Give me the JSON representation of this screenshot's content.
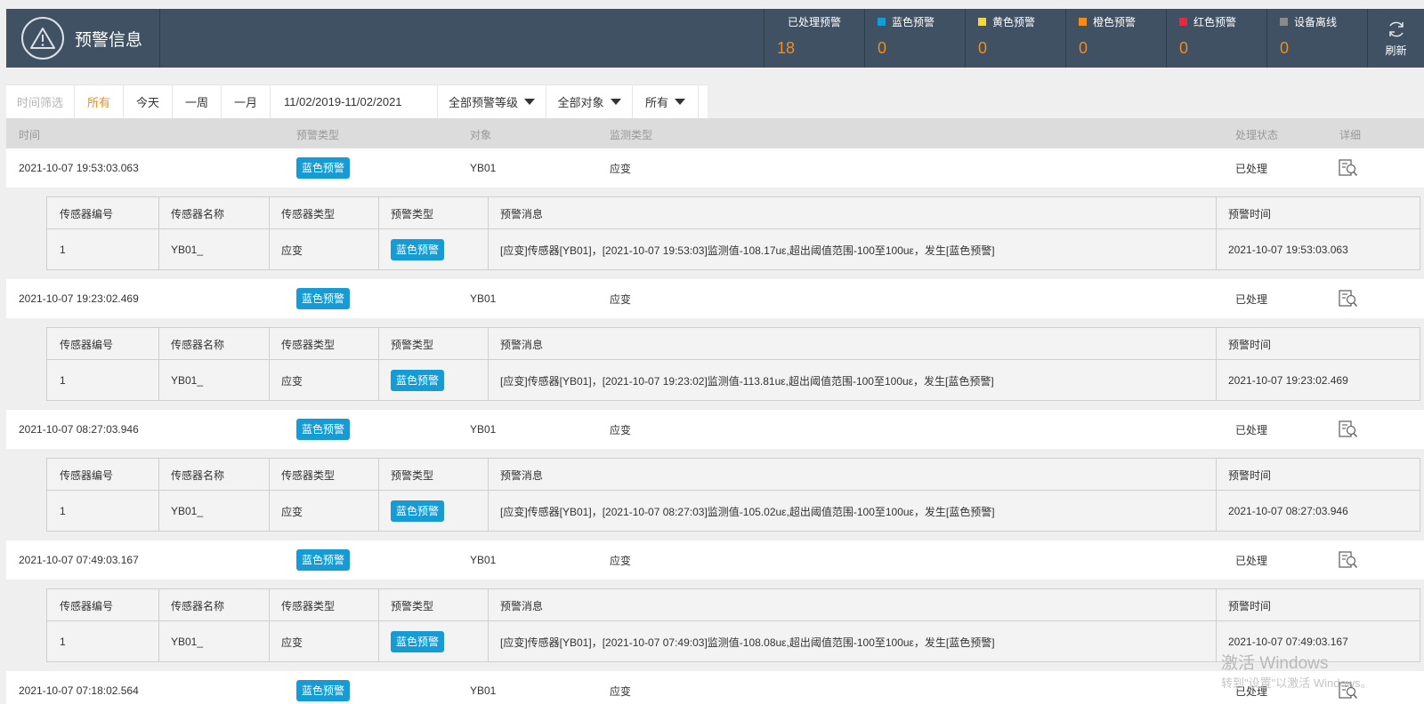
{
  "header": {
    "title": "预警信息",
    "stats": [
      {
        "label": "已处理预警",
        "value": "18",
        "swatch": ""
      },
      {
        "label": "蓝色预警",
        "value": "0",
        "swatch": "#169bd5"
      },
      {
        "label": "黄色预警",
        "value": "0",
        "swatch": "#f5d63d"
      },
      {
        "label": "橙色预警",
        "value": "0",
        "swatch": "#f28c1b"
      },
      {
        "label": "红色预警",
        "value": "0",
        "swatch": "#e8283c"
      },
      {
        "label": "设备离线",
        "value": "0",
        "swatch": "#8a8a8a"
      }
    ],
    "refresh_label": "刷新"
  },
  "filters": {
    "label": "时间筛选",
    "options": [
      "所有",
      "今天",
      "一周",
      "一月"
    ],
    "active": "所有",
    "date_range": "11/02/2019-11/02/2021",
    "level_dropdown": "全部预警等级",
    "object_dropdown": "全部对象",
    "status_dropdown": "所有"
  },
  "columns": {
    "time": "时间",
    "alert_type": "预警类型",
    "object": "对象",
    "monitor_type": "监测类型",
    "status": "处理状态",
    "detail": "详细"
  },
  "sub_columns": {
    "sensor_id": "传感器编号",
    "sensor_name": "传感器名称",
    "sensor_type": "传感器类型",
    "alert_type": "预警类型",
    "message": "预警消息",
    "alert_time": "预警时间"
  },
  "alerts": [
    {
      "time": "2021-10-07 19:53:03.063",
      "alert_type": "蓝色预警",
      "object": "YB01",
      "monitor_type": "应变",
      "status": "已处理",
      "detail": {
        "sensor_id": "1",
        "sensor_name": "YB01_",
        "sensor_type": "应变",
        "alert_type": "蓝色预警",
        "message": "[应变]传感器[YB01]，[2021-10-07 19:53:03]监测值-108.17uε,超出阈值范围-100至100uε，发生[蓝色预警]",
        "alert_time": "2021-10-07 19:53:03.063"
      }
    },
    {
      "time": "2021-10-07 19:23:02.469",
      "alert_type": "蓝色预警",
      "object": "YB01",
      "monitor_type": "应变",
      "status": "已处理",
      "detail": {
        "sensor_id": "1",
        "sensor_name": "YB01_",
        "sensor_type": "应变",
        "alert_type": "蓝色预警",
        "message": "[应变]传感器[YB01]，[2021-10-07 19:23:02]监测值-113.81uε,超出阈值范围-100至100uε，发生[蓝色预警]",
        "alert_time": "2021-10-07 19:23:02.469"
      }
    },
    {
      "time": "2021-10-07 08:27:03.946",
      "alert_type": "蓝色预警",
      "object": "YB01",
      "monitor_type": "应变",
      "status": "已处理",
      "detail": {
        "sensor_id": "1",
        "sensor_name": "YB01_",
        "sensor_type": "应变",
        "alert_type": "蓝色预警",
        "message": "[应变]传感器[YB01]，[2021-10-07 08:27:03]监测值-105.02uε,超出阈值范围-100至100uε，发生[蓝色预警]",
        "alert_time": "2021-10-07 08:27:03.946"
      }
    },
    {
      "time": "2021-10-07 07:49:03.167",
      "alert_type": "蓝色预警",
      "object": "YB01",
      "monitor_type": "应变",
      "status": "已处理",
      "detail": {
        "sensor_id": "1",
        "sensor_name": "YB01_",
        "sensor_type": "应变",
        "alert_type": "蓝色预警",
        "message": "[应变]传感器[YB01]，[2021-10-07 07:49:03]监测值-108.08uε,超出阈值范围-100至100uε，发生[蓝色预警]",
        "alert_time": "2021-10-07 07:49:03.167"
      }
    },
    {
      "time": "2021-10-07 07:18:02.564",
      "alert_type": "蓝色预警",
      "object": "YB01",
      "monitor_type": "应变",
      "status": "已处理"
    }
  ],
  "watermark": {
    "line1": "激活 Windows",
    "line2": "转到\"设置\"以激活 Windows。"
  }
}
